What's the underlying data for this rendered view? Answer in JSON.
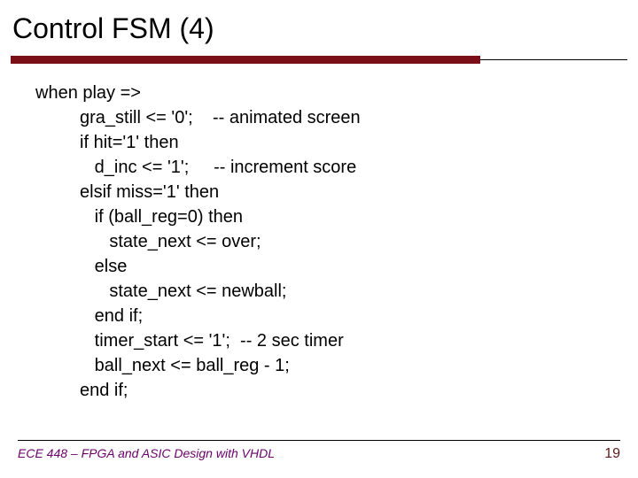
{
  "title": "Control FSM (4)",
  "code_lines": [
    "when play =>",
    "         gra_still <= '0';    -- animated screen",
    "         if hit='1' then",
    "            d_inc <= '1';     -- increment score",
    "         elsif miss='1' then",
    "            if (ball_reg=0) then",
    "               state_next <= over;",
    "            else",
    "               state_next <= newball;",
    "            end if;",
    "            timer_start <= '1';  -- 2 sec timer",
    "            ball_next <= ball_reg - 1;",
    "         end if;"
  ],
  "footer": {
    "left": "ECE 448 – FPGA and ASIC Design with VHDL",
    "page": "19"
  }
}
